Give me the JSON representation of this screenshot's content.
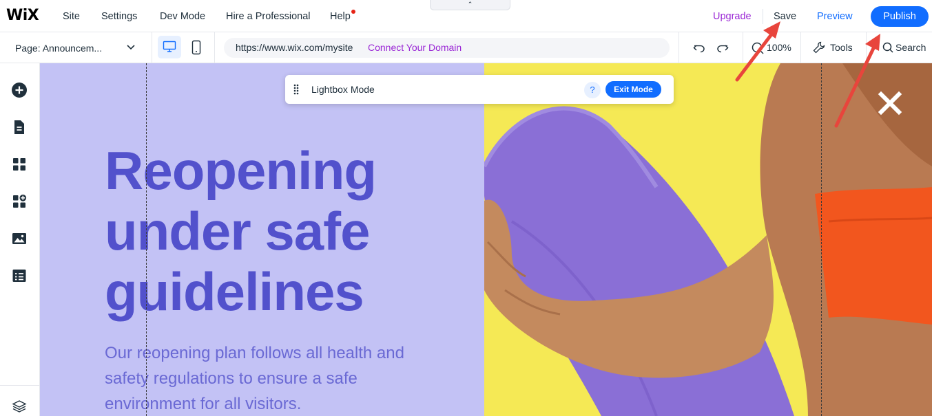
{
  "topbar": {
    "logo": "WiX",
    "menu": [
      "Site",
      "Settings",
      "Dev Mode",
      "Hire a Professional",
      "Help"
    ],
    "collapse_glyph": "⌃",
    "upgrade": "Upgrade",
    "save": "Save",
    "preview": "Preview",
    "publish": "Publish"
  },
  "subbar": {
    "page_label": "Page: Announcem...",
    "url": "https://www.wix.com/mysite",
    "connect_domain": "Connect Your Domain",
    "zoom": "100%",
    "tools": "Tools",
    "search": "Search"
  },
  "sidebar": {
    "icons": [
      "add-icon",
      "pages-icon",
      "apps-icon",
      "add-apps-icon",
      "media-icon",
      "cms-icon",
      "layers-icon"
    ]
  },
  "lightbox": {
    "mode_label": "Lightbox Mode",
    "help_glyph": "?",
    "exit_label": "Exit Mode"
  },
  "canvas": {
    "headline": "Reopening\nunder safe\nguidelines",
    "body": "Our reopening plan follows all health and safety regulations to ensure a safe environment for all visitors."
  },
  "colors": {
    "accent_blue": "#116dff",
    "upgrade_purple": "#9a27d5",
    "left_panel_bg": "#c3c2f5",
    "headline": "#5251cc",
    "right_panel_bg": "#f5e955",
    "annotation_arrow": "#e8453c"
  }
}
